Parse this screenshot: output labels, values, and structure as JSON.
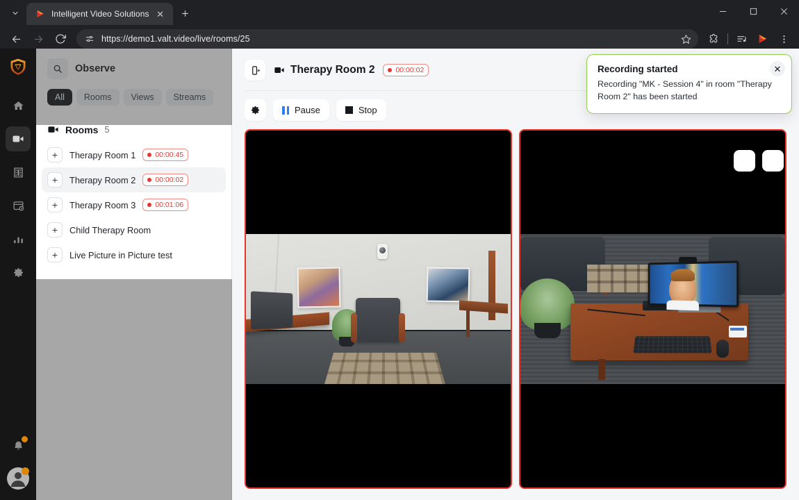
{
  "browser": {
    "tab": {
      "title": "Intelligent Video Solutions",
      "favicon_icon": "ivs-play-logo-icon",
      "close_icon": "close-icon"
    },
    "tab_list_icon": "chevron-down-icon",
    "new_tab_icon": "plus-icon",
    "window_controls": {
      "minimize_icon": "minimize-icon",
      "maximize_icon": "maximize-icon",
      "close_icon": "close-icon"
    },
    "toolbar": {
      "back_icon": "back-arrow-icon",
      "forward_icon": "forward-arrow-icon",
      "reload_icon": "reload-icon",
      "site_info_icon": "site-settings-icon",
      "url": "https://demo1.valt.video/live/rooms/25",
      "bookmark_icon": "star-icon",
      "extensions_icon": "extensions-puzzle-icon",
      "media_icon": "media-list-icon",
      "app_icon": "ivs-play-logo-icon",
      "menu_icon": "three-dot-menu-icon"
    }
  },
  "rail": {
    "logo_icon": "ivs-shield-logo-icon",
    "items": [
      {
        "name": "home",
        "icon": "home-icon",
        "active": false
      },
      {
        "name": "live",
        "icon": "video-camera-icon",
        "active": true
      },
      {
        "name": "recordings",
        "icon": "film-strip-icon",
        "active": false
      },
      {
        "name": "scheduled",
        "icon": "archive-clock-icon",
        "active": false
      },
      {
        "name": "reports",
        "icon": "bar-chart-icon",
        "active": false
      },
      {
        "name": "settings",
        "icon": "gear-icon",
        "active": false
      }
    ],
    "notifications_icon": "bell-icon",
    "notifications_badge_color": "#e08700",
    "avatar_icon": "user-avatar-icon",
    "avatar_badge_color": "#e08700"
  },
  "sidebar": {
    "search_icon": "search-icon",
    "title": "Observe",
    "filters": [
      {
        "label": "All",
        "active": true
      },
      {
        "label": "Rooms",
        "active": false
      },
      {
        "label": "Views",
        "active": false
      },
      {
        "label": "Streams",
        "active": false
      }
    ],
    "section": {
      "icon": "video-camera-icon",
      "label": "Rooms",
      "count": "5"
    },
    "rooms": [
      {
        "name": "Therapy Room 1",
        "expand": "+",
        "recording": true,
        "timer": "00:00:45",
        "selected": false
      },
      {
        "name": "Therapy Room 2",
        "expand": "+",
        "recording": true,
        "timer": "00:00:02",
        "selected": true
      },
      {
        "name": "Therapy Room 3",
        "expand": "+",
        "recording": true,
        "timer": "00:01:06",
        "selected": false
      },
      {
        "name": "Child Therapy Room",
        "expand": "+",
        "recording": false,
        "timer": "",
        "selected": false
      },
      {
        "name": "Live Picture in Picture test",
        "expand": "+",
        "recording": false,
        "timer": "",
        "selected": false
      }
    ]
  },
  "main": {
    "layout_toggle_icon": "portrait-layout-icon",
    "room_icon": "video-camera-icon",
    "room_title": "Therapy Room 2",
    "timer": "00:00:02",
    "toolbar": {
      "settings_icon": "gear-icon",
      "pause_label": "Pause",
      "pause_icon": "pause-icon",
      "stop_label": "Stop",
      "stop_icon": "stop-icon"
    },
    "videos": [
      {
        "name": "camera-feed-1",
        "border_color": "#e8342b",
        "recording": true
      },
      {
        "name": "camera-feed-2",
        "border_color": "#e8342b",
        "recording": true
      }
    ]
  },
  "toast": {
    "title": "Recording started",
    "message": "Recording \"MK - Session 4\" in room \"Therapy Room 2\" has been started",
    "close_icon": "close-icon",
    "border_color": "#8fd14f"
  },
  "colors": {
    "recording_red": "#e8342b",
    "accent_blue": "#2d7ff9",
    "toast_green": "#8fd14f",
    "badge_orange": "#e08700"
  }
}
